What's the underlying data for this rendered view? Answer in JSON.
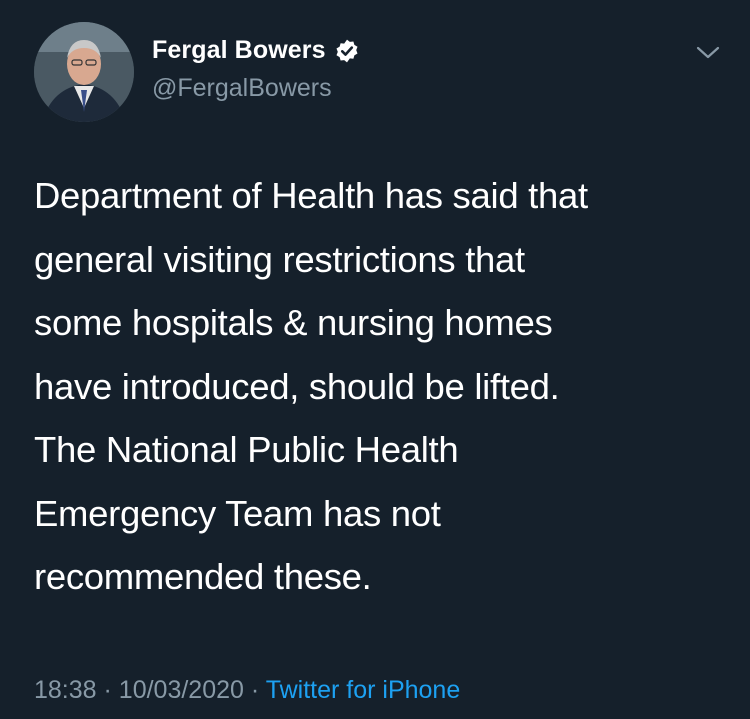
{
  "tweet": {
    "author": {
      "display_name": "Fergal Bowers",
      "handle": "@FergalBowers",
      "verified": true,
      "avatar_icon": "profile-photo"
    },
    "menu_icon": "chevron-down-icon",
    "text_lines": [
      "Department of Health has said that",
      "general visiting restrictions that",
      "some hospitals & nursing homes",
      "have introduced, should be lifted.",
      "The National Public Health",
      "Emergency Team has not",
      "recommended these."
    ],
    "time": "18:38",
    "date": "10/03/2020",
    "separator": "·",
    "source": "Twitter for iPhone"
  },
  "colors": {
    "background": "#15202b",
    "text": "#ffffff",
    "secondary_text": "#8899a6",
    "accent": "#1da1f2"
  }
}
